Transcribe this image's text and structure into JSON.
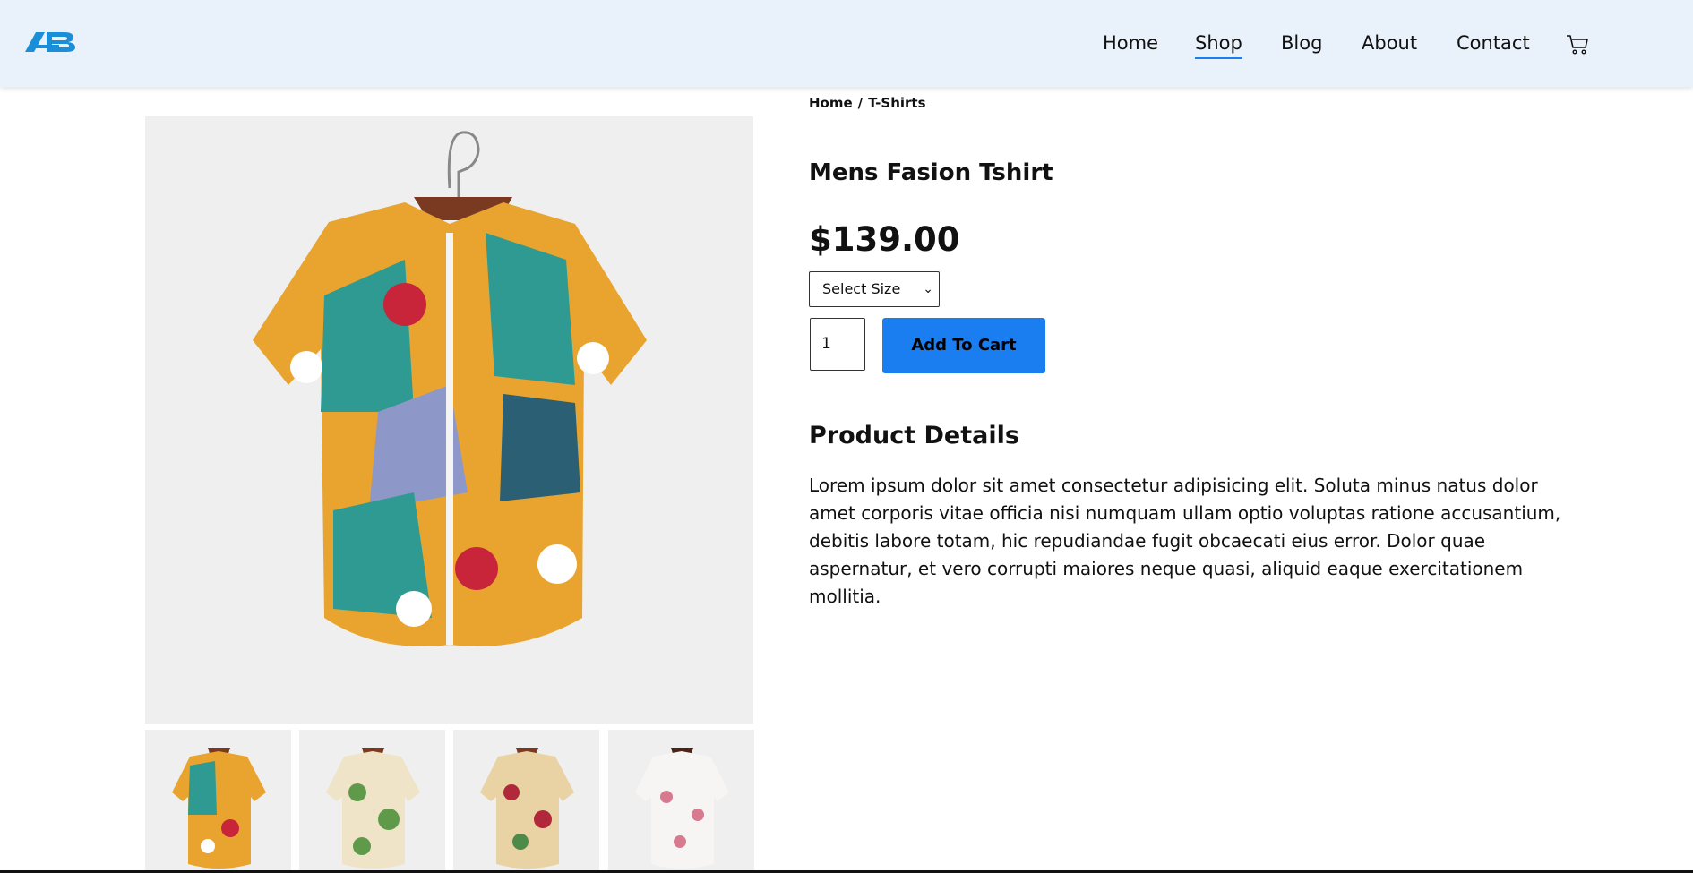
{
  "header": {
    "logo_alt": "AB",
    "nav": [
      {
        "label": "Home",
        "active": false
      },
      {
        "label": "Shop",
        "active": true
      },
      {
        "label": "Blog",
        "active": false
      },
      {
        "label": "About",
        "active": false
      },
      {
        "label": "Contact",
        "active": false
      }
    ],
    "cart_icon": "cart-icon"
  },
  "breadcrumb": {
    "items": [
      "Home",
      "T-Shirts"
    ],
    "separator": "/"
  },
  "product": {
    "title": "Mens Fasion Tshirt",
    "price": "$139.00",
    "size_select": {
      "selected": "Select Size"
    },
    "quantity": "1",
    "add_to_cart_label": "Add To Cart",
    "details_heading": "Product Details",
    "details_text": "Lorem ipsum dolor sit amet consectetur adipisicing elit. Soluta minus natus dolor amet corporis vitae officia nisi numquam ullam optio voluptas ratione accusantium, debitis labore totam, hic repudiandae fugit obcaecati eius error. Dolor quae aspernatur, et vero corrupti maiores neque quasi, aliquid eaque exercitationem mollitia."
  },
  "colors": {
    "accent": "#1a7ef0",
    "header_bg": "#e9f1fb",
    "image_bg": "#efefef"
  }
}
